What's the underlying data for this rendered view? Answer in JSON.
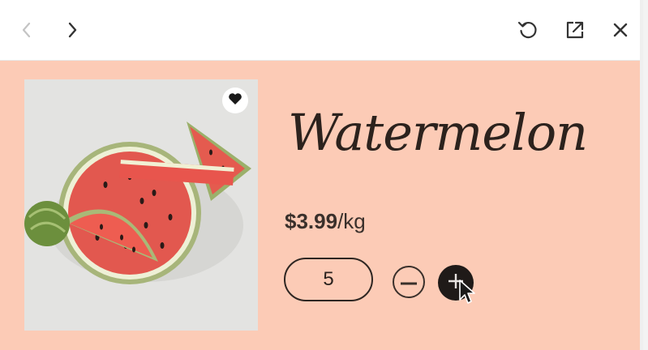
{
  "toolbar": {
    "back_icon": "chevron-left-icon",
    "forward_icon": "chevron-right-icon",
    "refresh_icon": "refresh-icon",
    "popout_icon": "external-link-icon",
    "close_icon": "close-icon"
  },
  "product": {
    "title": "Watermelon",
    "price_amount": "$3.99",
    "price_unit": "/kg",
    "image": "watermelon-slices-image",
    "favorite_icon": "heart-icon"
  },
  "quantity": {
    "value": "5",
    "minus_icon": "minus-icon",
    "plus_icon": "plus-icon"
  },
  "colors": {
    "background": "#fccbb6",
    "text": "#2c221d",
    "plus_button": "#1f1a18"
  }
}
